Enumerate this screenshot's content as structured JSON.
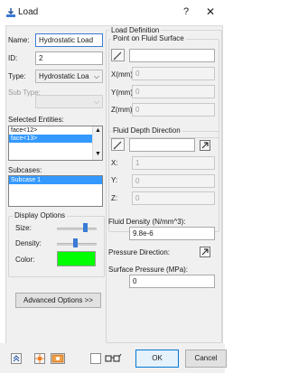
{
  "window": {
    "title": "Load",
    "help_glyph": "?",
    "close_glyph": "✕"
  },
  "left": {
    "name_label": "Name:",
    "name_value": "Hydrostatic Load",
    "id_label": "ID:",
    "id_value": "2",
    "type_label": "Type:",
    "type_value": "Hydrostatic Loa",
    "subtype_label": "Sub Type:",
    "selected_entities_label": "Selected Entities:",
    "entities": [
      "face<12>",
      "face<13>"
    ],
    "subcases_label": "Subcases:",
    "subcases": [
      "Subcase 1"
    ],
    "display_options_title": "Display Options",
    "size_label": "Size:",
    "size_level": 0.7,
    "density_label": "Density:",
    "density_level": 0.45,
    "color_label": "Color:",
    "color_value": "#00ff00",
    "advanced_button": "Advanced Options >>"
  },
  "right": {
    "load_definition_title": "Load Definition",
    "fluid_point_title": "Point on Fluid Surface",
    "x_label": "X(mm):",
    "x_value": "0",
    "y_label": "Y(mm):",
    "y_value": "0",
    "z_label": "Z(mm):",
    "z_value": "0",
    "fluid_depth_title": "Fluid Depth Direction",
    "dx_label": "X:",
    "dx_value": "1",
    "dy_label": "Y:",
    "dy_value": "0",
    "dz_label": "Z:",
    "dz_value": "0",
    "fluid_density_label": "Fluid Density (N/mm^3):",
    "fluid_density_value": "9.8e-6",
    "pressure_direction_label": "Pressure Direction:",
    "surface_pressure_label": "Surface Pressure (MPa):",
    "surface_pressure_value": "0"
  },
  "footer": {
    "ok_label": "OK",
    "cancel_label": "Cancel"
  },
  "colors": {
    "accent": "#3399ff",
    "green": "#00ff00"
  }
}
